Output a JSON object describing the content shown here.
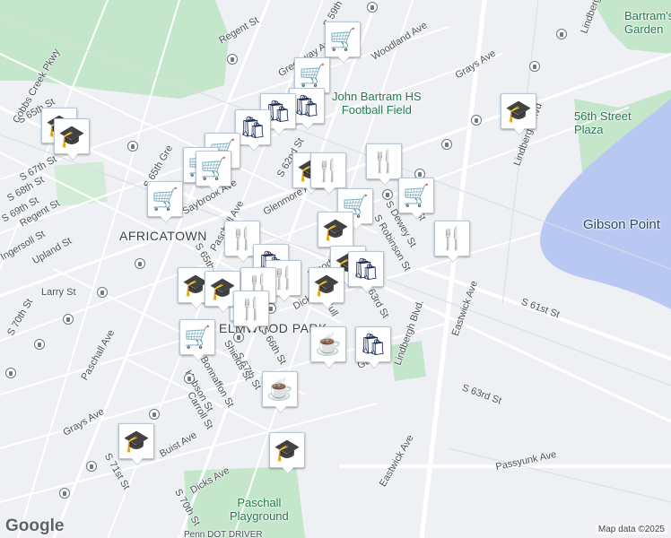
{
  "map": {
    "attribution": "Map data ©2025",
    "logo": "Google",
    "colors": {
      "marker_icon": "#1b2f57",
      "marker_border": "#b8c6d6",
      "park": "#bfe3c7",
      "water": "#b9c8f2",
      "road": "#ffffff"
    }
  },
  "places": {
    "africatown": "AFRICATOWN",
    "elmwood_park": "ELMWOOD PARK",
    "gibson_point": "Gibson Point",
    "bartram_garden": "Bartram's\nGarden",
    "plaza_56th": "56th Street\nPlaza",
    "bartram_field": "John Bartram HS\nFootball Field",
    "paschall_playground": "Paschall\nPlayground",
    "bottom_cut": "Penn DOT DRIVER"
  },
  "streets": {
    "regent_top": "Regent St",
    "s_59th": "S 59th St",
    "woodland": "Woodland Ave",
    "lindbergh_top": "Lindbergh",
    "grays_top": "Grays Ave",
    "greenway": "Greenway Ave",
    "cobbs": "Cobbs Creek Pkwy",
    "s_65th_top": "S 65th St",
    "s_67th": "S 67th St",
    "s_68th": "S 68th St",
    "s_69th": "S 69th St",
    "regent_left": "Regent St",
    "ingersoll": "Ingersoll St",
    "upland": "Upland St",
    "larry": "Larry St",
    "s_70th_left": "S 70th St",
    "paschall_left": "Paschall Ave",
    "s_65th_mid": "S 65th Gre",
    "saybrook": "Saybrook Ave",
    "paschall_mid": "Paschall Ave",
    "glenmore": "Glenmore Ave",
    "s_62nd": "S 62nd St",
    "lindbergh_blvd": "Lindbergh Blvd",
    "s_61st_a": "S 61st St",
    "s_dewey": "S Dewey St",
    "s_robinson": "S Robinson St",
    "s_61st_b": "S 61st St",
    "s_63rd": "S 63rd St",
    "s_65th_low": "S 65th",
    "wood_ave": "Wood Av",
    "dicks_low": "Dicke",
    "bull": "Bull",
    "s_66th": "S 66th St",
    "s_67th_low": "S 67th St",
    "shields": "Shields St",
    "bonnaffon": "Bonnaffon St",
    "hobson": "Hobson St",
    "carroll": "Carroll St",
    "grays_low": "Grays Ave",
    "buist": "Buist Ave",
    "s_71st": "S 71st St",
    "dicks_ave": "Dicks Ave",
    "s_70th_low": "S 70th St",
    "lindbergh_blvd_low": "Lindbergh Blvd.",
    "eastwick_low": "Eastwick Ave",
    "eastwick_right": "Eastwick Ave",
    "s_63rd_right": "S 63rd St",
    "passyunk": "Passyunk Ave",
    "guy": "Guy",
    "lindbergh_mid": "Lindbergh Blvd."
  },
  "markers": [
    {
      "type": "shopping-cart",
      "glyph": "🛒"
    },
    {
      "type": "shopping-cart",
      "glyph": "🛒"
    },
    {
      "type": "shopping-bag",
      "glyph": "🛍"
    },
    {
      "type": "shopping-bag",
      "glyph": "🛍"
    },
    {
      "type": "shopping-bag",
      "glyph": "🛍"
    },
    {
      "type": "school",
      "glyph": "🎓"
    },
    {
      "type": "school",
      "glyph": "🎓"
    },
    {
      "type": "school",
      "glyph": "🎓"
    },
    {
      "type": "shopping-cart",
      "glyph": "🛒"
    },
    {
      "type": "shopping-cart",
      "glyph": "🛒"
    },
    {
      "type": "shopping-cart",
      "glyph": "🛒"
    },
    {
      "type": "school",
      "glyph": "🎓"
    },
    {
      "type": "restaurant",
      "glyph": "🍴"
    },
    {
      "type": "restaurant",
      "glyph": "🍴"
    },
    {
      "type": "shopping-cart",
      "glyph": "🛒"
    },
    {
      "type": "shopping-cart",
      "glyph": "🛒"
    },
    {
      "type": "shopping-cart",
      "glyph": "🛒"
    },
    {
      "type": "school",
      "glyph": "🎓"
    },
    {
      "type": "restaurant",
      "glyph": "🍴"
    },
    {
      "type": "restaurant",
      "glyph": "🍴"
    },
    {
      "type": "shopping-bag",
      "glyph": "🛍"
    },
    {
      "type": "school",
      "glyph": "🎓"
    },
    {
      "type": "school",
      "glyph": "🎓"
    },
    {
      "type": "restaurant",
      "glyph": "🍴"
    },
    {
      "type": "restaurant",
      "glyph": "🍴"
    },
    {
      "type": "shopping-bag",
      "glyph": "🛍"
    },
    {
      "type": "school",
      "glyph": "🎓"
    },
    {
      "type": "shopping-cart",
      "glyph": "🛒"
    },
    {
      "type": "coffee",
      "glyph": "☕"
    },
    {
      "type": "shopping-bag",
      "glyph": "🛍"
    },
    {
      "type": "coffee",
      "glyph": "☕"
    },
    {
      "type": "school",
      "glyph": "🎓"
    },
    {
      "type": "school",
      "glyph": "🎓"
    },
    {
      "type": "restaurant",
      "glyph": "🍴"
    },
    {
      "type": "school",
      "glyph": "🎓"
    },
    {
      "type": "restaurant",
      "glyph": "🍴"
    }
  ]
}
